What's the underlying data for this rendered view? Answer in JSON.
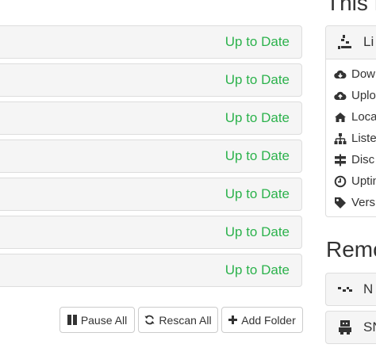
{
  "folders": [
    {
      "status": "Up to Date"
    },
    {
      "status": "Up to Date"
    },
    {
      "status": "Up to Date"
    },
    {
      "status": "Up to Date"
    },
    {
      "status": "Up to Date"
    },
    {
      "status": "Up to Date"
    },
    {
      "status": "Up to Date"
    }
  ],
  "actions": {
    "pause_all": "Pause All",
    "rescan_all": "Rescan All",
    "add_folder": "Add Folder"
  },
  "this_device": {
    "heading": "This D",
    "title": "Li",
    "stats": [
      "Dow",
      "Uplo",
      "Loca",
      "Liste",
      "Disc",
      "Uptin",
      "Versi"
    ]
  },
  "remote_devices": {
    "heading": "Remo",
    "items": [
      {
        "name": "N"
      },
      {
        "name": "SN"
      }
    ]
  },
  "colors": {
    "status_ok": "#2cb24c",
    "panel_bg": "#f5f5f5",
    "border": "#dddddd",
    "text": "#333333"
  },
  "icons": [
    "qrcode-icon",
    "cloud-download-icon",
    "cloud-upload-icon",
    "home-icon",
    "sitemap-icon",
    "signpost-icon",
    "clock-icon",
    "tag-icon",
    "pause-icon",
    "refresh-icon",
    "plus-icon",
    "device-icon"
  ]
}
